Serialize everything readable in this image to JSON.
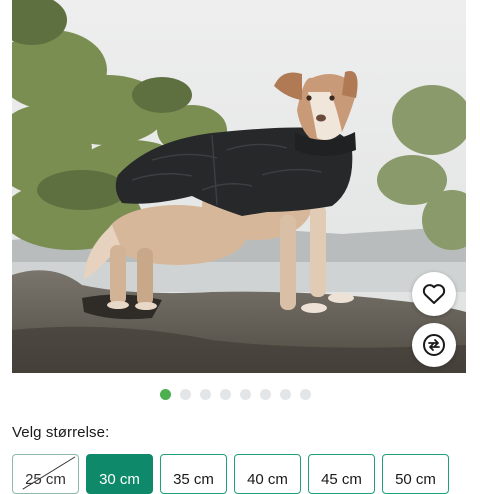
{
  "product_image": {
    "alt": "",
    "current_slide": 1,
    "total_slides": 8
  },
  "actions": {
    "favorite_icon": "heart-outline-icon",
    "compare_icon": "compare-arrows-icon"
  },
  "colors": {
    "accent": "#0e8a6a",
    "border": "#1fa07a",
    "dot_active": "#4caf50",
    "dot_inactive": "#e3e6e8"
  },
  "size_selector": {
    "label": "Velg størrelse:",
    "options": [
      {
        "label": "25 cm",
        "state": "unavailable"
      },
      {
        "label": "30 cm",
        "state": "selected"
      },
      {
        "label": "35 cm",
        "state": "available"
      },
      {
        "label": "40 cm",
        "state": "available"
      },
      {
        "label": "45 cm",
        "state": "available"
      },
      {
        "label": "50 cm",
        "state": "available"
      }
    ]
  }
}
